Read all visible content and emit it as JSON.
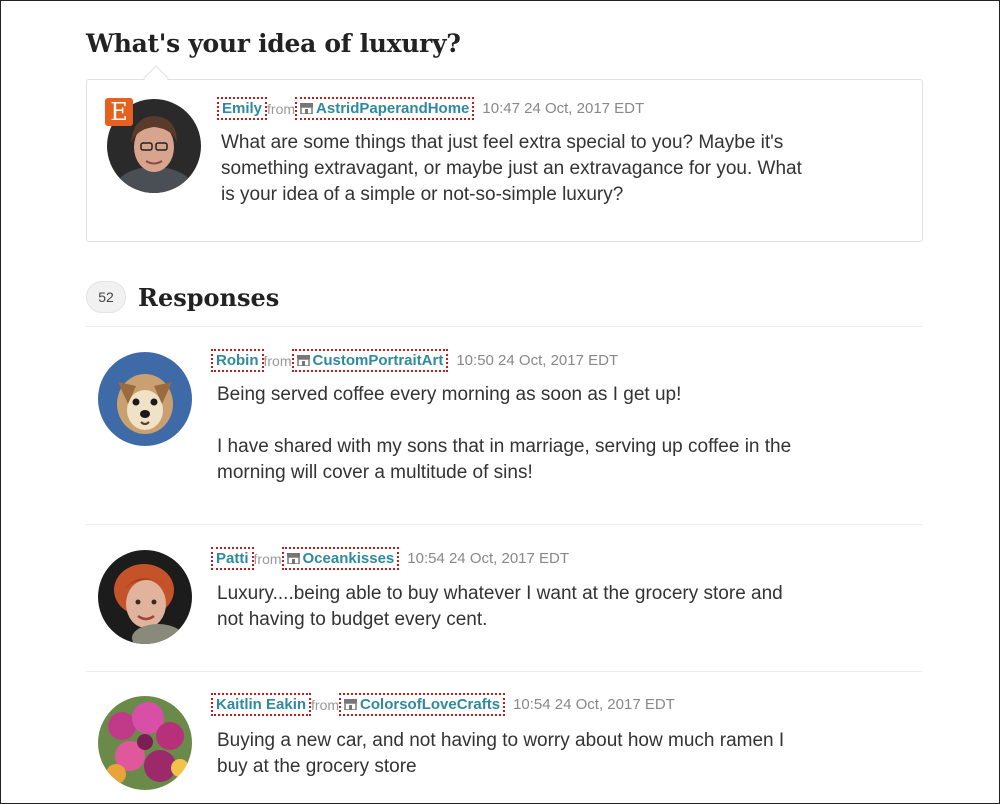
{
  "question": {
    "title": "What's your idea of luxury?",
    "author": "Emily",
    "from_word": "from",
    "shop": "AstridPaperandHome",
    "timestamp": "10:47 24 Oct, 2017 EDT",
    "text": "What are some things that just feel extra special to you? Maybe it's\nsomething extravagant, or maybe just an extravagance for you. What\nis your idea of a simple or not-so-simple luxury?",
    "badge_letter": "E",
    "badge_color": "#e5611f"
  },
  "responses_header": {
    "count": "52",
    "title": "Responses"
  },
  "responses": [
    {
      "author": "Robin",
      "from_word": "from",
      "shop": "CustomPortraitArt",
      "timestamp": "10:50 24 Oct, 2017 EDT",
      "text": "Being served coffee every morning as soon as I get up!\n\nI have shared with my sons that in marriage, serving up coffee in the\nmorning will cover a multitude of sins!"
    },
    {
      "author": "Patti",
      "from_word": "from",
      "shop": "Oceankisses",
      "timestamp": "10:54 24 Oct, 2017 EDT",
      "text": "Luxury....being able to buy whatever I want at the grocery store and\nnot having to budget every cent."
    },
    {
      "author": "Kaitlin Eakin",
      "from_word": "from",
      "shop": "ColorsofLoveCrafts",
      "timestamp": "10:54 24 Oct, 2017 EDT",
      "text": "Buying a new car, and not having to worry about how much ramen I\nbuy at the grocery store"
    }
  ],
  "colors": {
    "link": "#2f8a9f",
    "link_outline": "#b81f1f",
    "muted": "#888888"
  }
}
